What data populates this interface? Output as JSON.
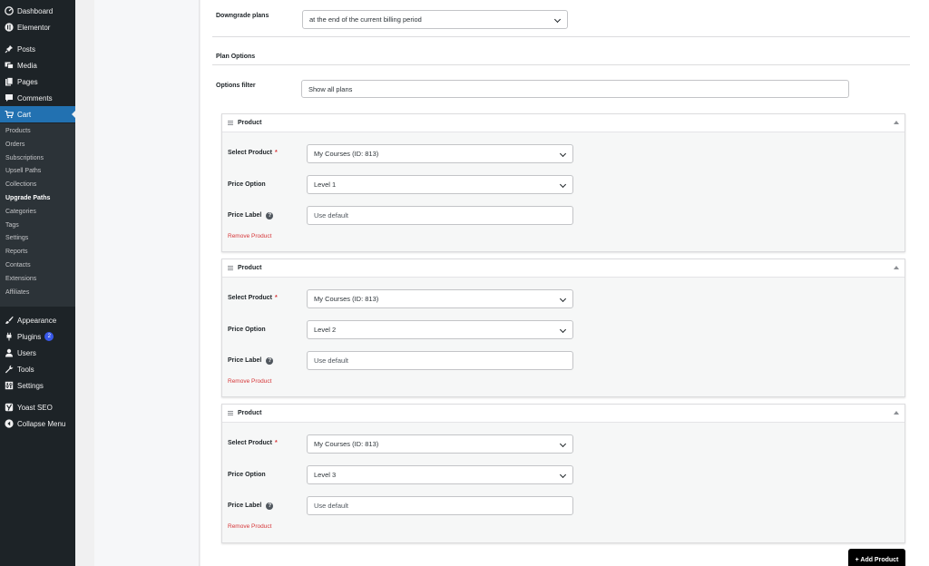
{
  "sidebar": {
    "top": [
      {
        "label": "Dashboard",
        "icon": "dashboard-icon"
      },
      {
        "label": "Elementor",
        "icon": "elementor-icon"
      }
    ],
    "main": [
      {
        "label": "Posts",
        "icon": "pin-icon"
      },
      {
        "label": "Media",
        "icon": "media-icon"
      },
      {
        "label": "Pages",
        "icon": "pages-icon"
      },
      {
        "label": "Comments",
        "icon": "comment-icon"
      },
      {
        "label": "Cart",
        "icon": "cart-icon"
      }
    ],
    "submenu": [
      "Products",
      "Orders",
      "Subscriptions",
      "Upsell Paths",
      "Collections",
      "Upgrade Paths",
      "Categories",
      "Tags",
      "Settings",
      "Reports",
      "Contacts",
      "Extensions",
      "Affiliates"
    ],
    "current_submenu": "Upgrade Paths",
    "bottom": [
      {
        "label": "Appearance",
        "icon": "brush-icon"
      },
      {
        "label": "Plugins",
        "icon": "plugin-icon",
        "badge": "2"
      },
      {
        "label": "Users",
        "icon": "user-icon"
      },
      {
        "label": "Tools",
        "icon": "wrench-icon"
      },
      {
        "label": "Settings",
        "icon": "settings-icon"
      },
      {
        "label": "Yoast SEO",
        "icon": "yoast-icon"
      },
      {
        "label": "Collapse Menu",
        "icon": "collapse-icon"
      }
    ]
  },
  "form": {
    "downgrade_label": "Downgrade plans",
    "downgrade_value": "at the end of the current billing period",
    "plan_options_heading": "Plan Options",
    "options_filter_label": "Options filter",
    "options_filter_value": "Show all plans"
  },
  "products": [
    {
      "title": "Product",
      "select_label": "Select Product",
      "required": "*",
      "select_value": "My Courses (ID: 813)",
      "price_option_label": "Price Option",
      "price_option_value": "Level 1",
      "price_label_label": "Price Label",
      "price_label_placeholder": "Use default",
      "remove_label": "Remove Product"
    },
    {
      "title": "Product",
      "select_label": "Select Product",
      "required": "*",
      "select_value": "My Courses (ID: 813)",
      "price_option_label": "Price Option",
      "price_option_value": "Level 2",
      "price_label_label": "Price Label",
      "price_label_placeholder": "Use default",
      "remove_label": "Remove Product"
    },
    {
      "title": "Product",
      "select_label": "Select Product",
      "required": "*",
      "select_value": "My Courses (ID: 813)",
      "price_option_label": "Price Option",
      "price_option_value": "Level 3",
      "price_label_label": "Price Label",
      "price_label_placeholder": "Use default",
      "remove_label": "Remove Product"
    }
  ],
  "add_product_label": "+ Add Product",
  "help_glyph": "?",
  "colors": {
    "sidebar_bg": "#1d2327",
    "active": "#2271b1",
    "danger": "#d63638",
    "badge": "#3858e9"
  }
}
